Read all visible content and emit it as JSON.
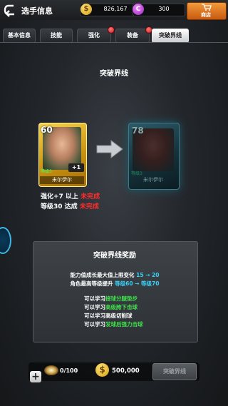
{
  "header": {
    "title": "选手信息",
    "coins": "826,167",
    "coin_symbol": "$",
    "gems": "300",
    "gem_symbol": "C",
    "shop_label": "商店"
  },
  "tabs": [
    {
      "label": "基本信息",
      "active": false,
      "badge": false
    },
    {
      "label": "技能",
      "active": false,
      "badge": false
    },
    {
      "label": "强化",
      "active": false,
      "badge": true
    },
    {
      "label": "装备",
      "active": false,
      "badge": true
    },
    {
      "label": "突破界线",
      "active": true,
      "badge": false
    }
  ],
  "section_title": "突破界线",
  "current_card": {
    "rating": "60",
    "plus": "+1",
    "level_label": "等级3",
    "name": "米尔伊尔"
  },
  "next_card": {
    "rating": "78",
    "level_label": "等级3",
    "name": "米尔伊尔"
  },
  "requirements": [
    {
      "text": "强化+7 以上",
      "status": "未完成"
    },
    {
      "text": "等级30 达成",
      "status": "未完成"
    }
  ],
  "reward": {
    "title": "突破界线奖励",
    "line1_prefix": "能力值成长最大值上限变化 ",
    "line1_value": "15 → 20",
    "line2_prefix": "角色最高等级提升 ",
    "line2_value": "等级60 → 等级70",
    "skills": [
      {
        "prefix": "可以学习",
        "skill": "接球分腿垫步",
        "highlight": true
      },
      {
        "prefix": "可以学习",
        "skill": "高级胯下击球",
        "highlight": true
      },
      {
        "prefix": "可以学习",
        "skill": "高级切削球",
        "highlight": false
      },
      {
        "prefix": "可以学习",
        "skill": "发球后强力击球",
        "highlight": true
      }
    ]
  },
  "cost": {
    "material": "0/100",
    "gold": "500,000",
    "gold_symbol": "$",
    "button_label": "突破界线",
    "add_symbol": "+"
  },
  "colors": {
    "incomplete": "#ff2d2d",
    "value_highlight": "#38d0f5",
    "skill_highlight": "#3fe04a",
    "shop_orange": "#e07a22"
  }
}
